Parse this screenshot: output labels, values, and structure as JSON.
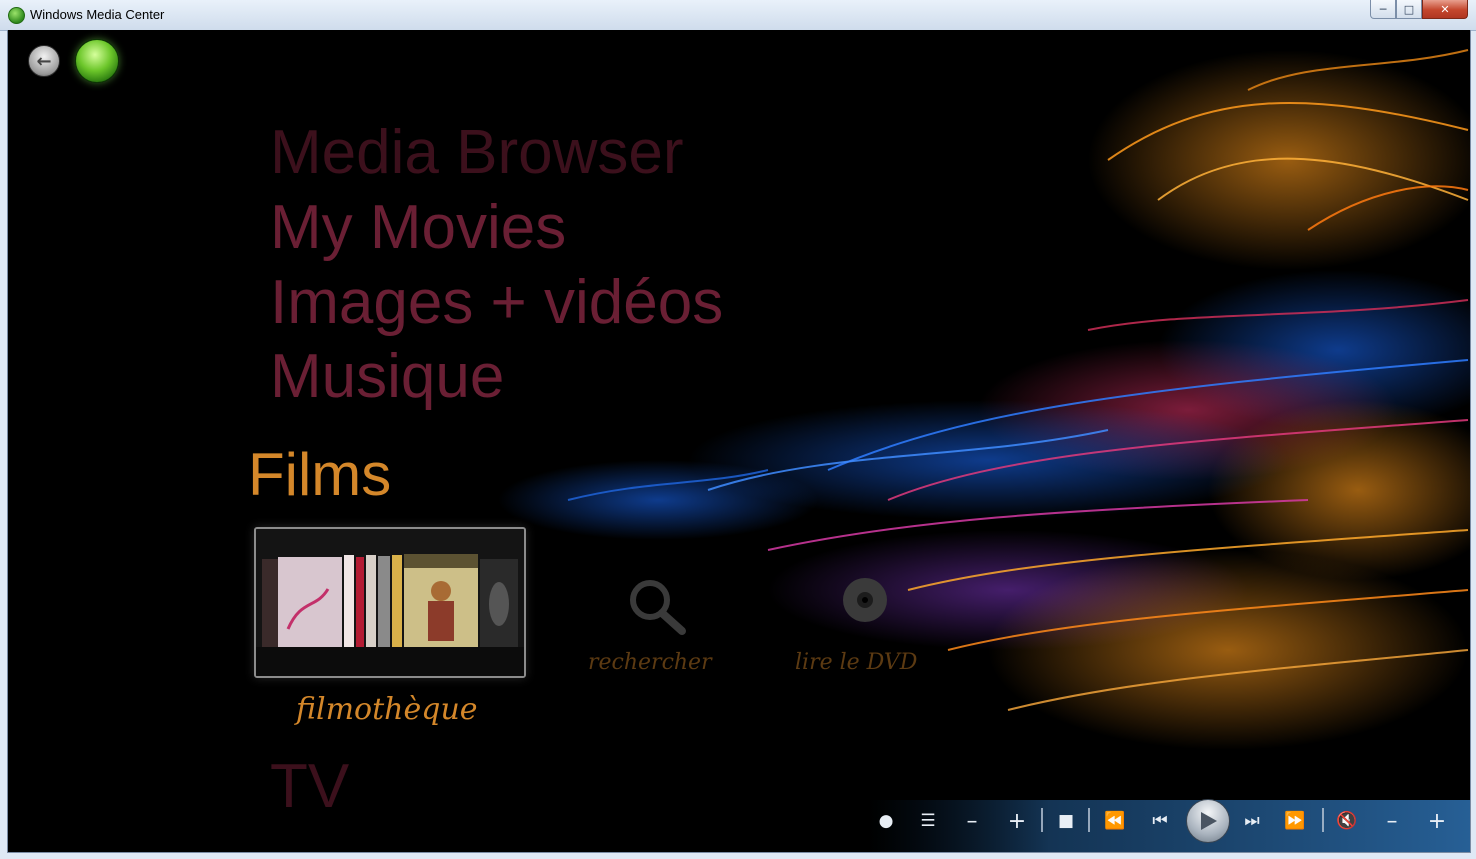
{
  "window": {
    "title": "Windows Media Center",
    "buttons": [
      "minimize",
      "maximize",
      "close"
    ]
  },
  "nav": {
    "back_icon": "back-arrow-icon",
    "start_icon": "windows-start-orb-icon"
  },
  "menu": {
    "items_above": [
      "Media Browser",
      "My Movies",
      "Images + vidéos",
      "Musique"
    ],
    "current": "Films",
    "item_below": "TV"
  },
  "films_strip": {
    "tiles": [
      {
        "label": "filmothèque",
        "selected": true,
        "icon": "dvd-shelf-thumbnail"
      },
      {
        "label": "rechercher",
        "selected": false,
        "icon": "search-icon"
      },
      {
        "label": "lire le DVD",
        "selected": false,
        "icon": "disc-icon"
      }
    ]
  },
  "transport": {
    "buttons": [
      "record",
      "guide",
      "channel-down",
      "channel-up",
      "stop",
      "rewind",
      "previous",
      "play",
      "next",
      "fast-forward",
      "mute",
      "volume-down",
      "volume-up"
    ]
  },
  "colors": {
    "accent": "#d4872a",
    "menu_text": "#6a1f34",
    "background": "#000000"
  }
}
